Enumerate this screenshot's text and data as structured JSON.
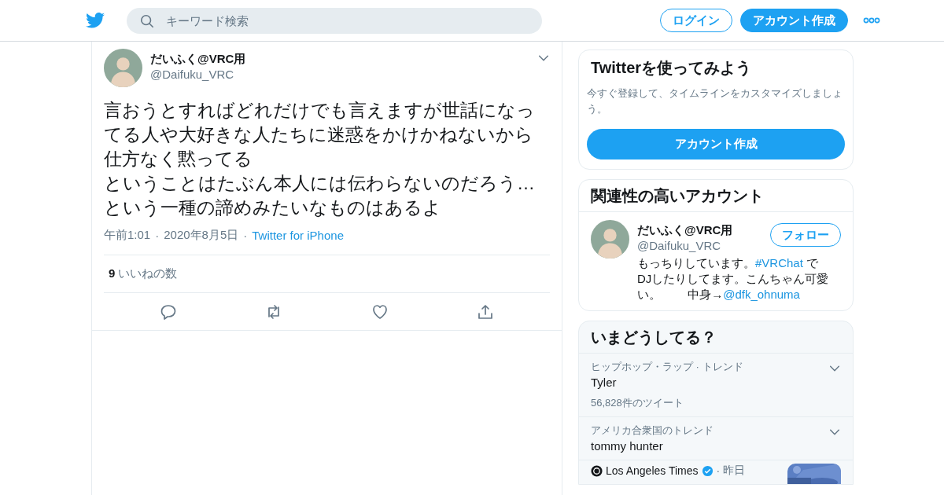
{
  "header": {
    "search": {
      "placeholder": "キーワード検索"
    },
    "buttons": [
      {
        "label": "ログイン",
        "kind": "outline"
      },
      {
        "label": "アカウント作成",
        "kind": "filled"
      }
    ]
  },
  "tweet": {
    "name": "だいふく@VRC用",
    "handle": "@Daifuku_VRC",
    "paragraphs": [
      "言おうとすればどれだけでも言えますが世話になってる人や大好きな人たちに迷惑をかけかねないから仕方なく黙ってる",
      "ということはたぶん本人には伝わらないのだろう…という一種の諦めみたいなものはあるよ"
    ],
    "meta": [
      {
        "kind": "text",
        "text": "午前1:01"
      },
      {
        "kind": "sep",
        "text": "·"
      },
      {
        "kind": "text",
        "text": "2020年8月5日"
      },
      {
        "kind": "sep",
        "text": "·"
      },
      {
        "kind": "link",
        "text": "Twitter for iPhone"
      }
    ],
    "likes_count": "9",
    "likes_label": "いいねの数"
  },
  "signup_card": {
    "title": "Twitterを使ってみよう",
    "description": "今すぐ登録して、タイムラインをカスタマイズしましょう。",
    "button": "アカウント作成"
  },
  "related": {
    "title": "関連性の高いアカウント",
    "accounts": [
      {
        "name": "だいふく@VRC用",
        "handle": "@Daifuku_VRC",
        "button": "フォロー",
        "bio": [
          {
            "kind": "text",
            "text": "もっちりしています。"
          },
          {
            "kind": "hashtag",
            "text": "#VRChat"
          },
          {
            "kind": "text",
            "text": " でDJしたりしてます。こんちゃん可愛い。　　 中身→"
          },
          {
            "kind": "mention",
            "text": "@dfk_ohnuma"
          }
        ]
      }
    ]
  },
  "trends": {
    "title": "いまどうしてる？",
    "items": [
      {
        "kind": "trend",
        "context": "ヒップホップ・ラップ · トレンド",
        "name": "Tyler",
        "count": "56,828件のツイート"
      },
      {
        "kind": "trend",
        "context": "アメリカ合衆国のトレンド",
        "name": "tommy hunter"
      },
      {
        "kind": "news",
        "source": "Los Angeles Times",
        "verified": true,
        "separator": "·",
        "time": "昨日"
      }
    ]
  }
}
